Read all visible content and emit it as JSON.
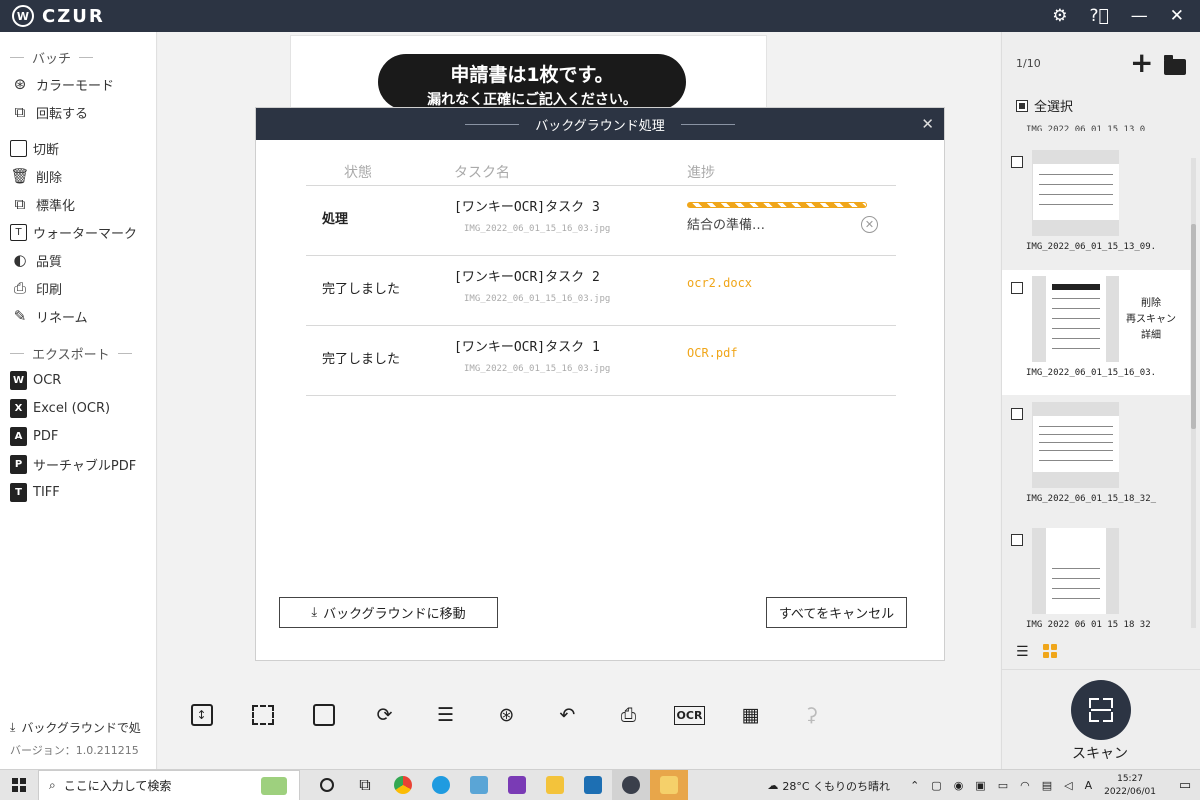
{
  "titlebar": {
    "logo_badge": "W",
    "app_name": "CZUR"
  },
  "sidebar": {
    "batch_title": "バッチ",
    "batch_items": [
      {
        "label": "カラーモード",
        "icon": "color-mode-icon"
      },
      {
        "label": "回転する",
        "icon": "rotate-icon"
      },
      {
        "label": "切断",
        "icon": "crop-icon"
      },
      {
        "label": "削除",
        "icon": "trash-icon"
      },
      {
        "label": "標準化",
        "icon": "standardize-icon"
      },
      {
        "label": "ウォーターマーク",
        "icon": "watermark-icon"
      },
      {
        "label": "品質",
        "icon": "quality-icon"
      },
      {
        "label": "印刷",
        "icon": "print-icon"
      },
      {
        "label": "リネーム",
        "icon": "rename-icon"
      }
    ],
    "export_title": "エクスポート",
    "export_items": [
      {
        "label": "OCR",
        "icon_text": "W"
      },
      {
        "label": "Excel (OCR)",
        "icon_text": "X"
      },
      {
        "label": "PDF",
        "icon_text": "A"
      },
      {
        "label": "サーチャブルPDF",
        "icon_text": "P"
      },
      {
        "label": "TIFF",
        "icon_text": "T"
      }
    ],
    "background_label": "バックグラウンドで処",
    "version": "バージョン：1.0.211215"
  },
  "preview": {
    "line1": "申請書は1枚です。",
    "line2": "漏れなく正確にご記入ください。"
  },
  "dialog": {
    "title": "バックグラウンド処理",
    "headers": {
      "status": "状態",
      "task": "タスク名",
      "progress": "進捗"
    },
    "rows": [
      {
        "status": "処理",
        "task": "[ワンキーOCR]タスク 3",
        "file": "IMG_2022_06_01_15_16_03.jpg",
        "progress_label": "結合の準備…",
        "progress": 1.0
      },
      {
        "status": "完了しました",
        "task": "[ワンキーOCR]タスク 2",
        "file": "IMG_2022_06_01_15_16_03.jpg",
        "output": "ocr2.docx"
      },
      {
        "status": "完了しました",
        "task": "[ワンキーOCR]タスク 1",
        "file": "IMG_2022_06_01_15_16_03.jpg",
        "output": "OCR.pdf"
      }
    ],
    "move_bg_button": "バックグラウンドに移動",
    "cancel_all_button": "すべてをキャンセル"
  },
  "right_panel": {
    "page_counter": "1/10",
    "select_all": "全選択",
    "cut_name": "IMG_2022_06_01_15_13_0",
    "thumbs": [
      {
        "name": "IMG_2022_06_01_15_13_09."
      },
      {
        "name": "IMG_2022_06_01_15_16_03."
      },
      {
        "name": "IMG_2022_06_01_15_18_32_"
      },
      {
        "name": "IMG 2022 06 01 15 18 32"
      }
    ],
    "context_menu": [
      "削除",
      "再スキャン",
      "詳細"
    ],
    "scan_label": "スキャン"
  },
  "taskbar": {
    "search_placeholder": "ここに入力して検索",
    "weather": "28°C くもりのち晴れ",
    "ime": "A",
    "time": "15:27",
    "date": "2022/06/01"
  },
  "colors": {
    "accent": "#f0a61a",
    "header": "#2c3443"
  }
}
